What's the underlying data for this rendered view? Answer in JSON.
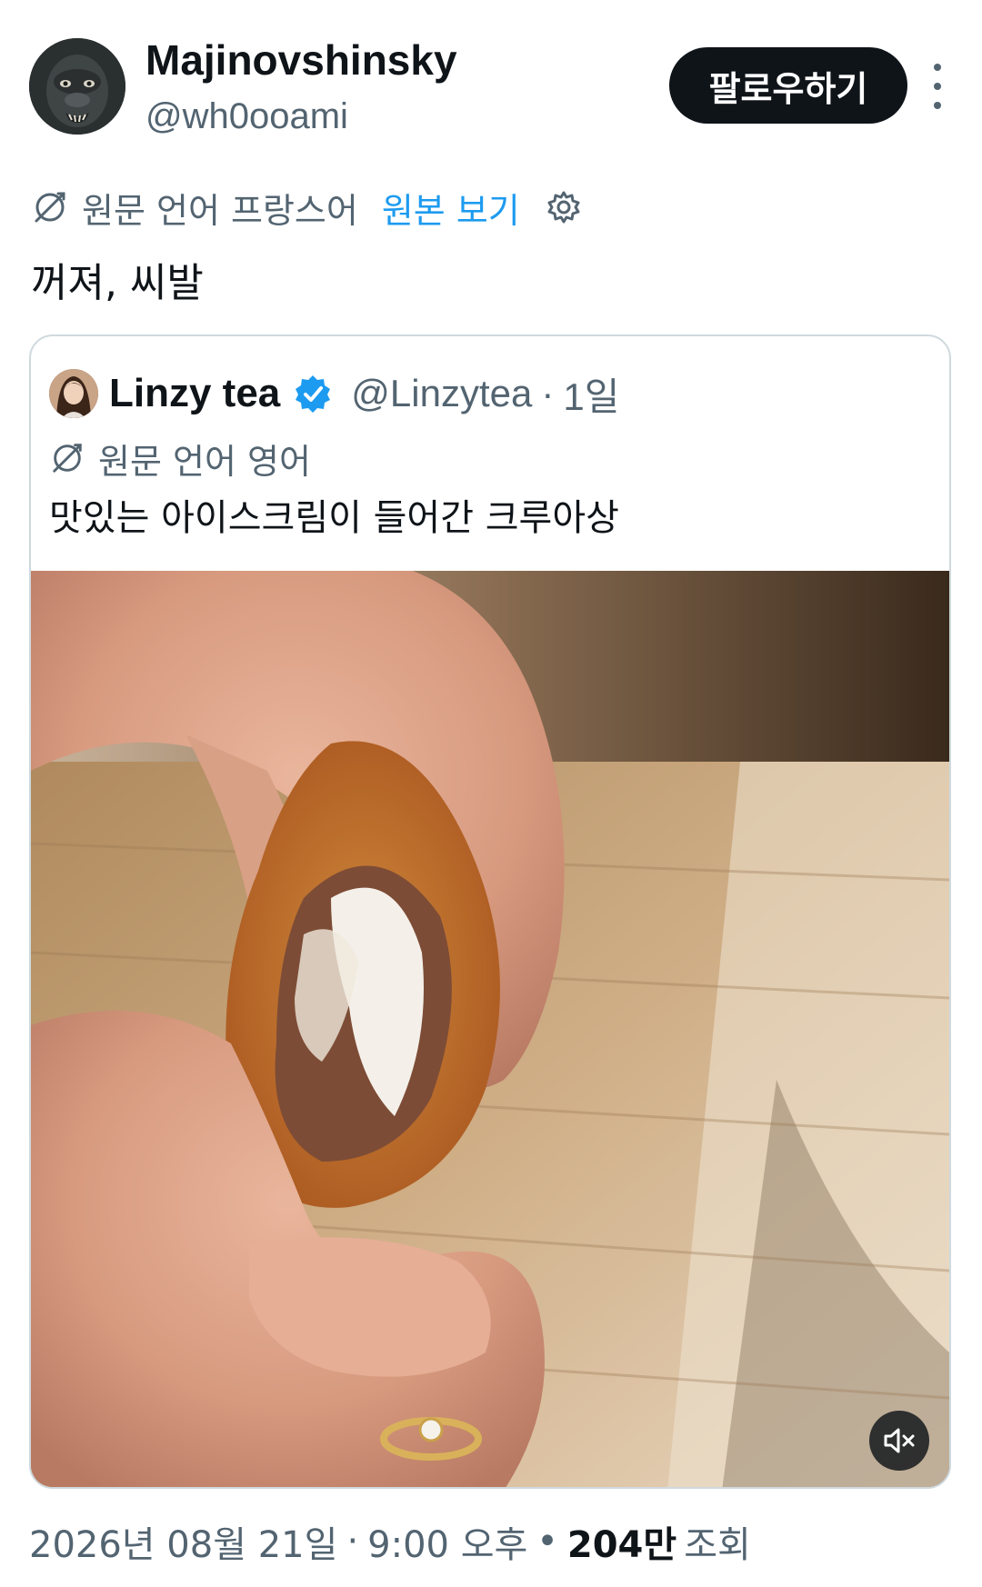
{
  "author": {
    "display_name": "Majinovshinsky",
    "handle": "@wh0ooami",
    "follow_label": "팔로우하기",
    "more_icon": "more-vertical-icon"
  },
  "translation": {
    "language_note": "원문 언어 프랑스어",
    "view_original_label": "원본 보기",
    "settings_icon": "gear-icon",
    "globe_icon": "translate-icon"
  },
  "tweet": {
    "text": "꺼져, 씨발"
  },
  "quote": {
    "display_name": "Linzy tea",
    "verified": true,
    "handle": "@Linzytea",
    "separator": "·",
    "age": "1일",
    "language_note": "원문 언어 영어",
    "text": "맛있는 아이스크림이 들어간 크루아상",
    "media_description_icon": "video-thumbnail",
    "mute_icon": "muted-speaker-icon"
  },
  "meta": {
    "date": "2026년 08월 21일",
    "dot1": "·",
    "time": "9:00 오후",
    "dot2": "•",
    "views_count": "204만",
    "views_label": "조회"
  },
  "colors": {
    "text": "#0f1419",
    "secondary": "#536471",
    "link": "#1d9bf0",
    "border": "#cfd9de",
    "button_bg": "#0f1419"
  }
}
